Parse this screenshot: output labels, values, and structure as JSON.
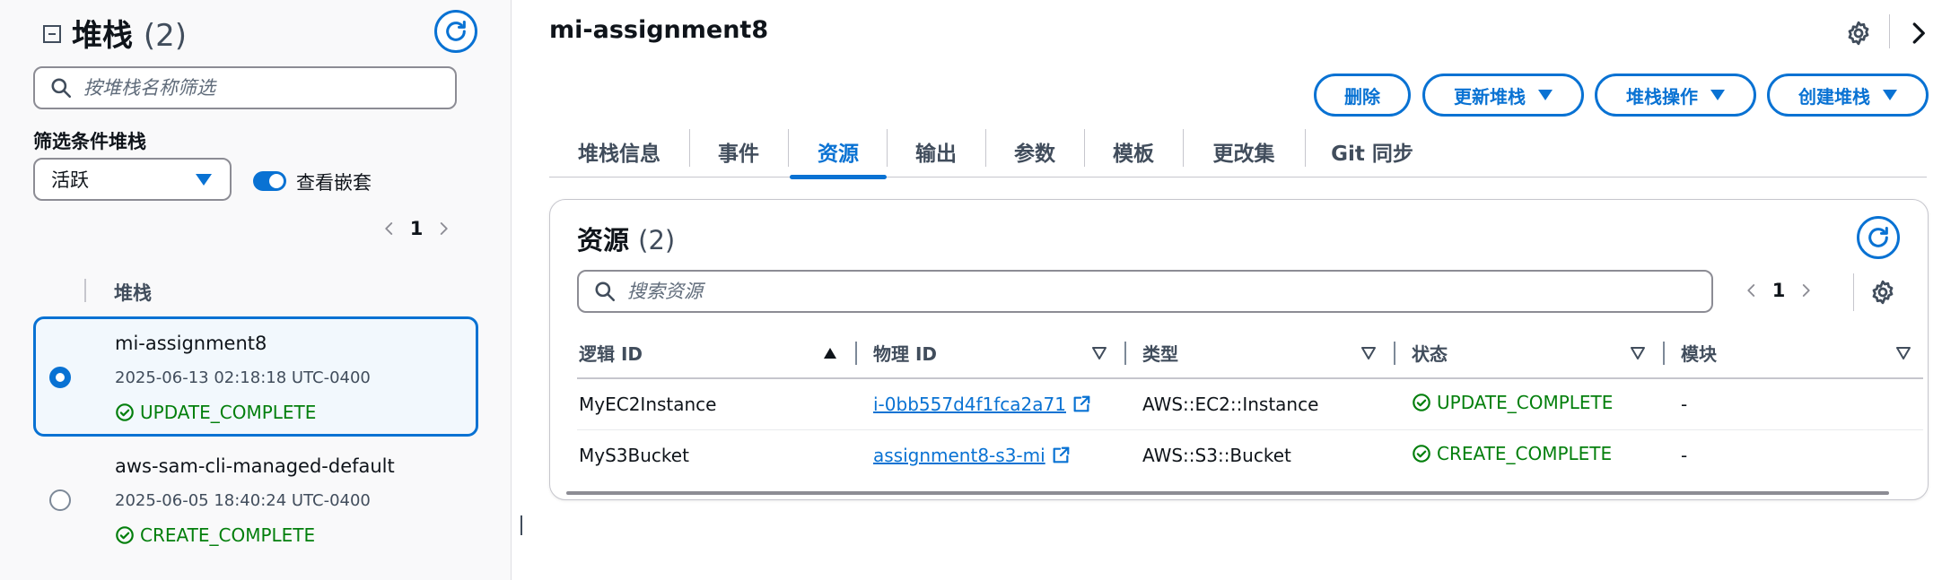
{
  "left_panel": {
    "title": "堆栈",
    "count": "(2)",
    "search_placeholder": "按堆栈名称筛选",
    "filter_label": "筛选条件堆栈",
    "filter_value": "活跃",
    "toggle_label": "查看嵌套",
    "toggle_on": true,
    "page": "1",
    "column_header": "堆栈",
    "stacks": [
      {
        "name": "mi-assignment8",
        "time": "2025-06-13 02:18:18 UTC-0400",
        "status": "UPDATE_COMPLETE",
        "selected": true
      },
      {
        "name": "aws-sam-cli-managed-default",
        "time": "2025-06-05 18:40:24 UTC-0400",
        "status": "CREATE_COMPLETE",
        "selected": false
      }
    ]
  },
  "main": {
    "title": "mi-assignment8",
    "buttons": {
      "delete": "删除",
      "update": "更新堆栈",
      "stack_actions": "堆栈操作",
      "create": "创建堆栈"
    },
    "tabs": [
      {
        "label": "堆栈信息",
        "active": false
      },
      {
        "label": "事件",
        "active": false
      },
      {
        "label": "资源",
        "active": true
      },
      {
        "label": "输出",
        "active": false
      },
      {
        "label": "参数",
        "active": false
      },
      {
        "label": "模板",
        "active": false
      },
      {
        "label": "更改集",
        "active": false
      },
      {
        "label": "Git 同步",
        "active": false
      }
    ],
    "resources": {
      "title": "资源",
      "count": "(2)",
      "search_placeholder": "搜索资源",
      "page": "1",
      "columns": [
        "逻辑 ID",
        "物理 ID",
        "类型",
        "状态",
        "模块"
      ],
      "rows": [
        {
          "logical_id": "MyEC2Instance",
          "physical_id": "i-0bb557d4f1fca2a71",
          "type": "AWS::EC2::Instance",
          "status": "UPDATE_COMPLETE",
          "module": "-"
        },
        {
          "logical_id": "MyS3Bucket",
          "physical_id": "assignment8-s3-mi",
          "type": "AWS::S3::Bucket",
          "status": "CREATE_COMPLETE",
          "module": "-"
        }
      ]
    }
  },
  "colors": {
    "accent": "#0972d3",
    "success": "#037f0c",
    "text": "#0f141a",
    "muted": "#414d5c",
    "panel_bg": "#f9f9fa",
    "selected_bg": "#f2f8fd"
  },
  "icons": [
    "collapse-icon",
    "refresh-icon",
    "search-icon",
    "caret-down-icon",
    "chevron-left-icon",
    "chevron-right-icon",
    "check-circle-icon",
    "gear-icon",
    "external-link-icon",
    "sort-asc-icon",
    "sort-desc-icon"
  ]
}
